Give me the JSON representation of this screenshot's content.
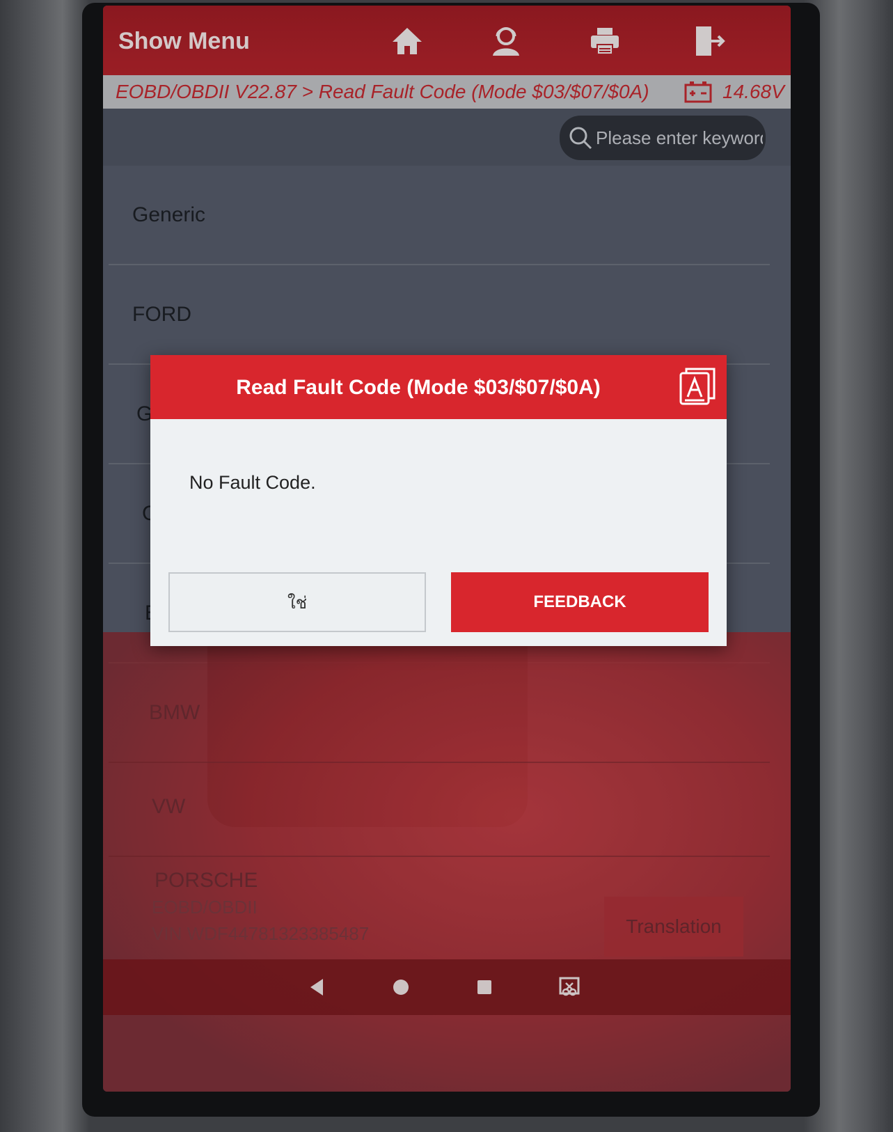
{
  "header": {
    "show_menu_label": "Show Menu",
    "icons": [
      "home-icon",
      "user-support-icon",
      "printer-icon",
      "exit-icon"
    ]
  },
  "breadcrumb": {
    "text": "EOBD/OBDII V22.87 > Read Fault Code (Mode $03/$07/$0A)",
    "voltage": "14.68V"
  },
  "search": {
    "placeholder": "Please enter keyword"
  },
  "list": {
    "items": [
      "Generic",
      "FORD",
      "G",
      "C",
      "B",
      "BMW",
      "VW",
      "PORSCHE"
    ]
  },
  "footer": {
    "make": "EOBD/OBDII",
    "vin": "VIN WDF44781323385487",
    "translation_label": "Translation"
  },
  "dialog": {
    "title": "Read Fault Code (Mode $03/$07/$0A)",
    "message": "No Fault Code.",
    "yes_label": "ใช่",
    "feedback_label": "FEEDBACK"
  },
  "colors": {
    "brand_red": "#d8262d",
    "header_red": "#b0232b",
    "crumb_red": "#c0282f"
  }
}
